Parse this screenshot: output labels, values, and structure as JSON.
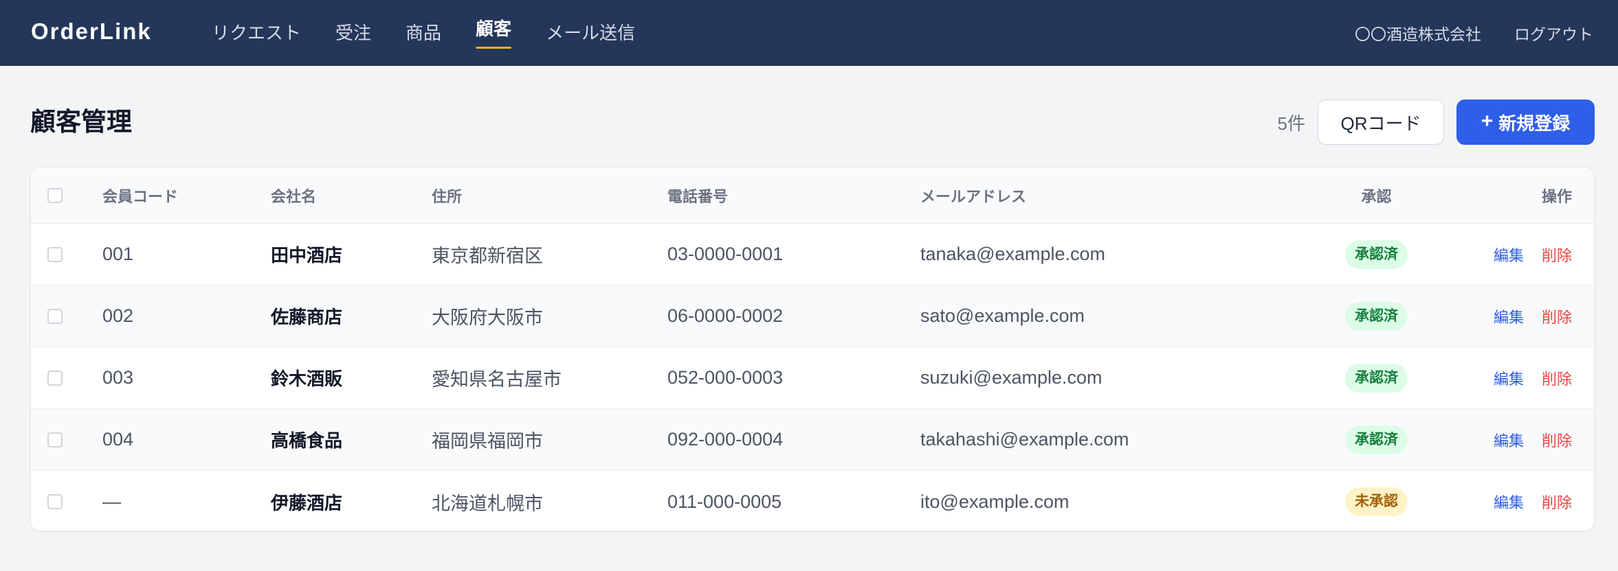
{
  "app": {
    "brand": "OrderLink"
  },
  "nav": {
    "items": [
      {
        "label": "リクエスト",
        "active": false
      },
      {
        "label": "受注",
        "active": false
      },
      {
        "label": "商品",
        "active": false
      },
      {
        "label": "顧客",
        "active": true
      },
      {
        "label": "メール送信",
        "active": false
      }
    ],
    "company": "〇〇酒造株式会社",
    "logout": "ログアウト"
  },
  "page": {
    "title": "顧客管理",
    "count": "5件",
    "qr_button": "QRコード",
    "new_button_icon": "+",
    "new_button": "新規登録"
  },
  "table": {
    "headers": {
      "code": "会員コード",
      "company": "会社名",
      "address": "住所",
      "phone": "電話番号",
      "email": "メールアドレス",
      "status": "承認",
      "actions": "操作"
    },
    "rows": [
      {
        "code": "001",
        "company": "田中酒店",
        "address": "東京都新宿区",
        "phone": "03-0000-0001",
        "email": "tanaka@example.com",
        "status": "承認済",
        "status_type": "approved",
        "edit": "編集",
        "delete": "削除"
      },
      {
        "code": "002",
        "company": "佐藤商店",
        "address": "大阪府大阪市",
        "phone": "06-0000-0002",
        "email": "sato@example.com",
        "status": "承認済",
        "status_type": "approved",
        "edit": "編集",
        "delete": "削除"
      },
      {
        "code": "003",
        "company": "鈴木酒販",
        "address": "愛知県名古屋市",
        "phone": "052-000-0003",
        "email": "suzuki@example.com",
        "status": "承認済",
        "status_type": "approved",
        "edit": "編集",
        "delete": "削除"
      },
      {
        "code": "004",
        "company": "高橋食品",
        "address": "福岡県福岡市",
        "phone": "092-000-0004",
        "email": "takahashi@example.com",
        "status": "承認済",
        "status_type": "approved",
        "edit": "編集",
        "delete": "削除"
      },
      {
        "code": "—",
        "company": "伊藤酒店",
        "address": "北海道札幌市",
        "phone": "011-000-0005",
        "email": "ito@example.com",
        "status": "未承認",
        "status_type": "pending",
        "edit": "編集",
        "delete": "削除"
      }
    ]
  },
  "colors": {
    "topbar": "#243659",
    "accent": "#2f5ee8",
    "active_underline": "#f2b01e",
    "approved_bg": "#dcfce7",
    "approved_text": "#15803d",
    "pending_bg": "#fef3c7",
    "pending_text": "#a16207",
    "delete": "#ef4444"
  }
}
